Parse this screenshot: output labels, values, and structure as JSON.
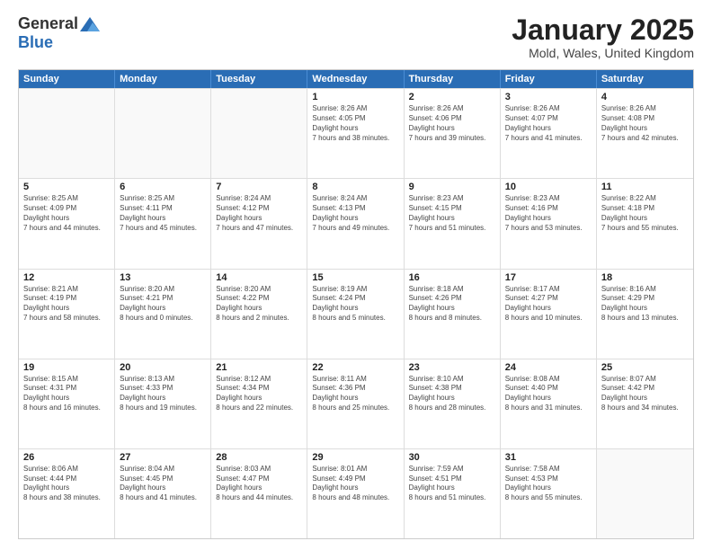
{
  "logo": {
    "general": "General",
    "blue": "Blue"
  },
  "header": {
    "title": "January 2025",
    "location": "Mold, Wales, United Kingdom"
  },
  "weekdays": [
    "Sunday",
    "Monday",
    "Tuesday",
    "Wednesday",
    "Thursday",
    "Friday",
    "Saturday"
  ],
  "weeks": [
    [
      {
        "day": "",
        "empty": true
      },
      {
        "day": "",
        "empty": true
      },
      {
        "day": "",
        "empty": true
      },
      {
        "day": "1",
        "sunrise": "8:26 AM",
        "sunset": "4:05 PM",
        "daylight": "7 hours and 38 minutes."
      },
      {
        "day": "2",
        "sunrise": "8:26 AM",
        "sunset": "4:06 PM",
        "daylight": "7 hours and 39 minutes."
      },
      {
        "day": "3",
        "sunrise": "8:26 AM",
        "sunset": "4:07 PM",
        "daylight": "7 hours and 41 minutes."
      },
      {
        "day": "4",
        "sunrise": "8:26 AM",
        "sunset": "4:08 PM",
        "daylight": "7 hours and 42 minutes."
      }
    ],
    [
      {
        "day": "5",
        "sunrise": "8:25 AM",
        "sunset": "4:09 PM",
        "daylight": "7 hours and 44 minutes."
      },
      {
        "day": "6",
        "sunrise": "8:25 AM",
        "sunset": "4:11 PM",
        "daylight": "7 hours and 45 minutes."
      },
      {
        "day": "7",
        "sunrise": "8:24 AM",
        "sunset": "4:12 PM",
        "daylight": "7 hours and 47 minutes."
      },
      {
        "day": "8",
        "sunrise": "8:24 AM",
        "sunset": "4:13 PM",
        "daylight": "7 hours and 49 minutes."
      },
      {
        "day": "9",
        "sunrise": "8:23 AM",
        "sunset": "4:15 PM",
        "daylight": "7 hours and 51 minutes."
      },
      {
        "day": "10",
        "sunrise": "8:23 AM",
        "sunset": "4:16 PM",
        "daylight": "7 hours and 53 minutes."
      },
      {
        "day": "11",
        "sunrise": "8:22 AM",
        "sunset": "4:18 PM",
        "daylight": "7 hours and 55 minutes."
      }
    ],
    [
      {
        "day": "12",
        "sunrise": "8:21 AM",
        "sunset": "4:19 PM",
        "daylight": "7 hours and 58 minutes."
      },
      {
        "day": "13",
        "sunrise": "8:20 AM",
        "sunset": "4:21 PM",
        "daylight": "8 hours and 0 minutes."
      },
      {
        "day": "14",
        "sunrise": "8:20 AM",
        "sunset": "4:22 PM",
        "daylight": "8 hours and 2 minutes."
      },
      {
        "day": "15",
        "sunrise": "8:19 AM",
        "sunset": "4:24 PM",
        "daylight": "8 hours and 5 minutes."
      },
      {
        "day": "16",
        "sunrise": "8:18 AM",
        "sunset": "4:26 PM",
        "daylight": "8 hours and 8 minutes."
      },
      {
        "day": "17",
        "sunrise": "8:17 AM",
        "sunset": "4:27 PM",
        "daylight": "8 hours and 10 minutes."
      },
      {
        "day": "18",
        "sunrise": "8:16 AM",
        "sunset": "4:29 PM",
        "daylight": "8 hours and 13 minutes."
      }
    ],
    [
      {
        "day": "19",
        "sunrise": "8:15 AM",
        "sunset": "4:31 PM",
        "daylight": "8 hours and 16 minutes."
      },
      {
        "day": "20",
        "sunrise": "8:13 AM",
        "sunset": "4:33 PM",
        "daylight": "8 hours and 19 minutes."
      },
      {
        "day": "21",
        "sunrise": "8:12 AM",
        "sunset": "4:34 PM",
        "daylight": "8 hours and 22 minutes."
      },
      {
        "day": "22",
        "sunrise": "8:11 AM",
        "sunset": "4:36 PM",
        "daylight": "8 hours and 25 minutes."
      },
      {
        "day": "23",
        "sunrise": "8:10 AM",
        "sunset": "4:38 PM",
        "daylight": "8 hours and 28 minutes."
      },
      {
        "day": "24",
        "sunrise": "8:08 AM",
        "sunset": "4:40 PM",
        "daylight": "8 hours and 31 minutes."
      },
      {
        "day": "25",
        "sunrise": "8:07 AM",
        "sunset": "4:42 PM",
        "daylight": "8 hours and 34 minutes."
      }
    ],
    [
      {
        "day": "26",
        "sunrise": "8:06 AM",
        "sunset": "4:44 PM",
        "daylight": "8 hours and 38 minutes."
      },
      {
        "day": "27",
        "sunrise": "8:04 AM",
        "sunset": "4:45 PM",
        "daylight": "8 hours and 41 minutes."
      },
      {
        "day": "28",
        "sunrise": "8:03 AM",
        "sunset": "4:47 PM",
        "daylight": "8 hours and 44 minutes."
      },
      {
        "day": "29",
        "sunrise": "8:01 AM",
        "sunset": "4:49 PM",
        "daylight": "8 hours and 48 minutes."
      },
      {
        "day": "30",
        "sunrise": "7:59 AM",
        "sunset": "4:51 PM",
        "daylight": "8 hours and 51 minutes."
      },
      {
        "day": "31",
        "sunrise": "7:58 AM",
        "sunset": "4:53 PM",
        "daylight": "8 hours and 55 minutes."
      },
      {
        "day": "",
        "empty": true
      }
    ]
  ],
  "labels": {
    "sunrise": "Sunrise:",
    "sunset": "Sunset:",
    "daylight": "Daylight hours"
  }
}
